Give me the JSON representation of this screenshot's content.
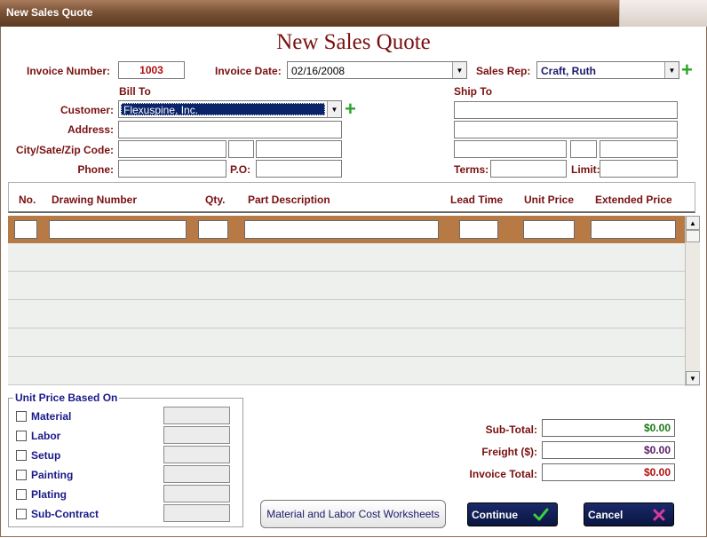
{
  "window": {
    "title": "New Sales Quote"
  },
  "heading": "New Sales Quote",
  "invoice": {
    "number_label": "Invoice Number:",
    "number": "1003",
    "date_label": "Invoice Date:",
    "date": "02/16/2008",
    "rep_label": "Sales Rep:",
    "rep": "Craft, Ruth"
  },
  "bill_to": {
    "title": "Bill To",
    "customer_label": "Customer:",
    "customer": "Flexuspine, Inc.",
    "address_label": "Address:",
    "csz_label": "City/Sate/Zip Code:",
    "phone_label": "Phone:",
    "po_label": "P.O:"
  },
  "ship_to": {
    "title": "Ship To",
    "terms_label": "Terms:",
    "limit_label": "Limit:"
  },
  "grid": {
    "columns": [
      "No.",
      "Drawing Number",
      "Qty.",
      "Part Description",
      "Lead Time",
      "Unit Price",
      "Extended Price"
    ]
  },
  "unit_price": {
    "title": "Unit Price Based On",
    "options": [
      "Material",
      "Labor",
      "Setup",
      "Painting",
      "Plating",
      "Sub-Contract"
    ]
  },
  "totals": {
    "subtotal_label": "Sub-Total:",
    "subtotal": "$0.00",
    "freight_label": "Freight ($):",
    "freight": "$0.00",
    "total_label": "Invoice Total:",
    "total": "$0.00",
    "colors": {
      "subtotal": "#1a7a1a",
      "freight": "#5a1a6a",
      "total": "#b01010"
    }
  },
  "buttons": {
    "worksheets": "Material and Labor Cost Worksheets",
    "continue": "Continue",
    "cancel": "Cancel"
  },
  "icons": {
    "continue": "check-icon",
    "cancel": "x-icon",
    "add": "plus-icon",
    "dropdown": "chevron-down-icon"
  }
}
